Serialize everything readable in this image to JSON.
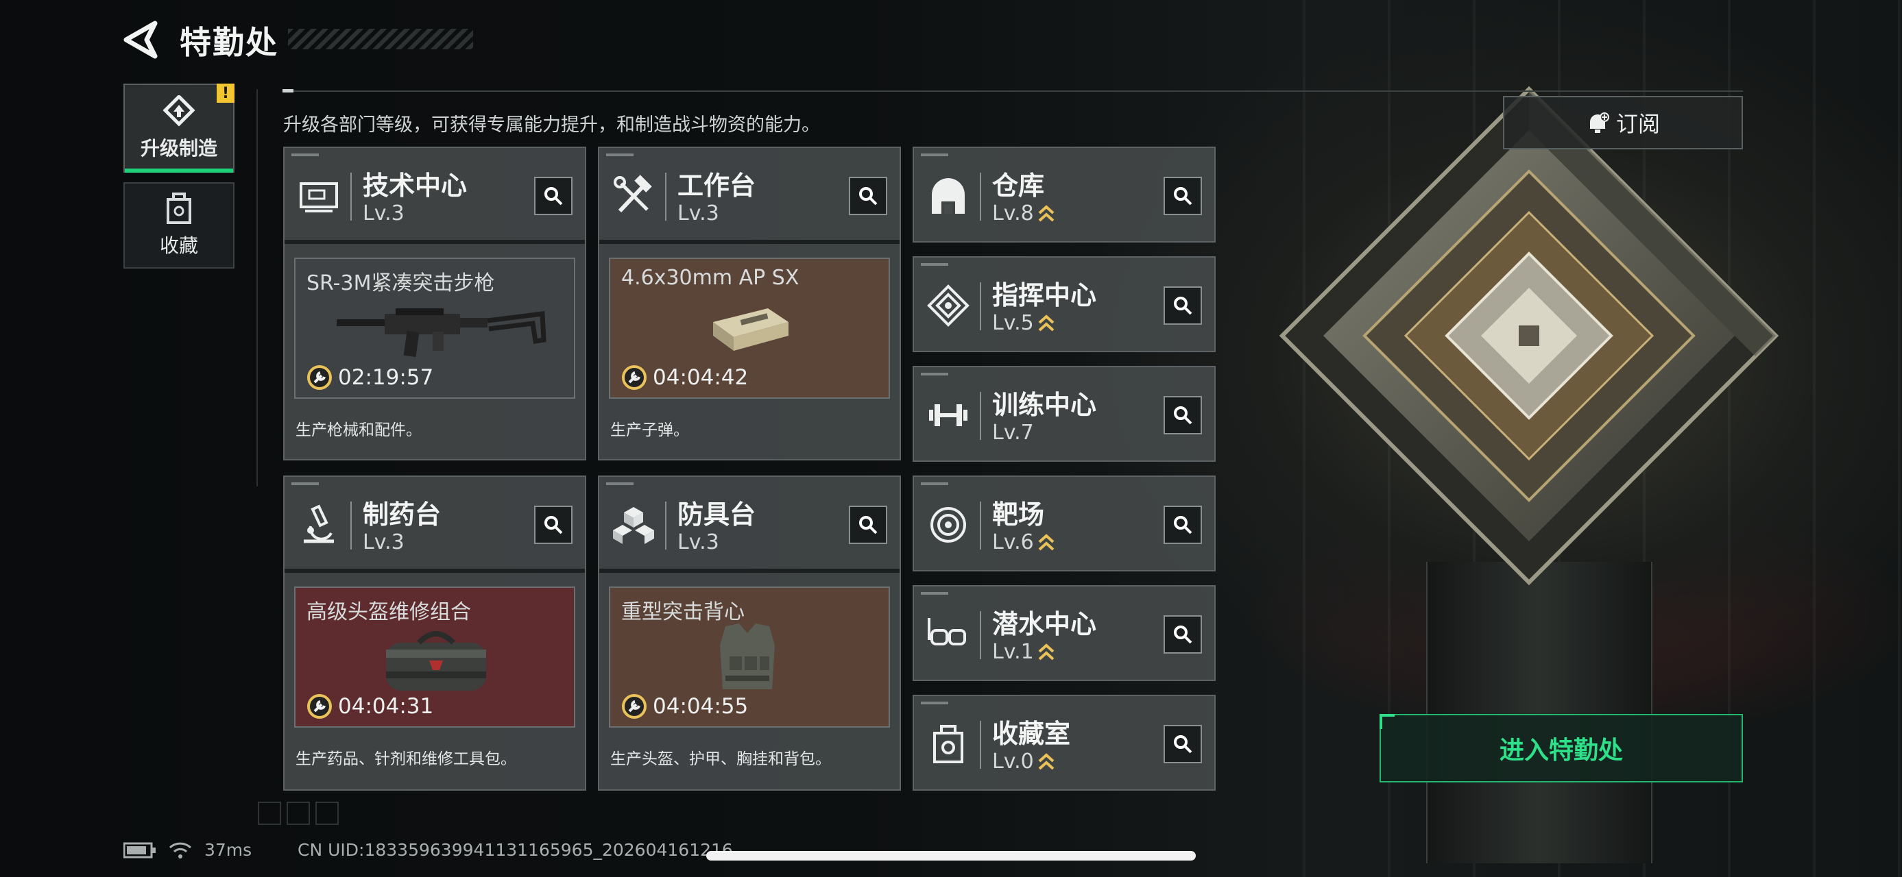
{
  "header": {
    "title": "特勤处",
    "subtitle": "升级各部门等级，可获得专属能力提升，和制造战斗物资的能力。"
  },
  "side_tabs": [
    {
      "label": "升级制造",
      "active": true,
      "badge": "!"
    },
    {
      "label": "收藏",
      "active": false
    }
  ],
  "departments_big": [
    {
      "name": "技术中心",
      "level": "Lv.3",
      "icon": "tech-center-icon",
      "item": "SR-3M紧凑突击步枪",
      "timer": "02:19:57",
      "desc": "生产枪械和配件。",
      "bg": "#3e4244"
    },
    {
      "name": "工作台",
      "level": "Lv.3",
      "icon": "hammer-wrench-icon",
      "item": "4.6x30mm AP SX",
      "timer": "04:04:42",
      "desc": "生产子弹。",
      "bg": "#5b4438"
    },
    {
      "name": "制药台",
      "level": "Lv.3",
      "icon": "microscope-icon",
      "item": "高级头盔维修组合",
      "timer": "04:04:31",
      "desc": "生产药品、针剂和维修工具包。",
      "bg": "#5e2c2e"
    },
    {
      "name": "防具台",
      "level": "Lv.3",
      "icon": "armor-cubes-icon",
      "item": "重型突击背心",
      "timer": "04:04:55",
      "desc": "生产头盔、护甲、胸挂和背包。",
      "bg": "#5a4236"
    }
  ],
  "departments_small": [
    {
      "name": "仓库",
      "level": "Lv.8",
      "icon": "warehouse-icon"
    },
    {
      "name": "指挥中心",
      "level": "Lv.5",
      "icon": "command-center-icon"
    },
    {
      "name": "训练中心",
      "level": "Lv.7",
      "icon": "dumbbell-icon"
    },
    {
      "name": "靶场",
      "level": "Lv.6",
      "icon": "target-icon"
    },
    {
      "name": "潜水中心",
      "level": "Lv.1",
      "icon": "diving-mask-icon"
    },
    {
      "name": "收藏室",
      "level": "Lv.0",
      "icon": "collection-room-icon"
    }
  ],
  "actions": {
    "subscribe": "订阅",
    "enter": "进入特勤处"
  },
  "status_bar": {
    "ping": "37ms",
    "uid": "CN UID:18335963994113116596​5_202604161216"
  },
  "colors": {
    "accent_green": "#2fe08a",
    "level_up_arrow": "#e9c25a",
    "badge_yellow": "#f2c531"
  }
}
